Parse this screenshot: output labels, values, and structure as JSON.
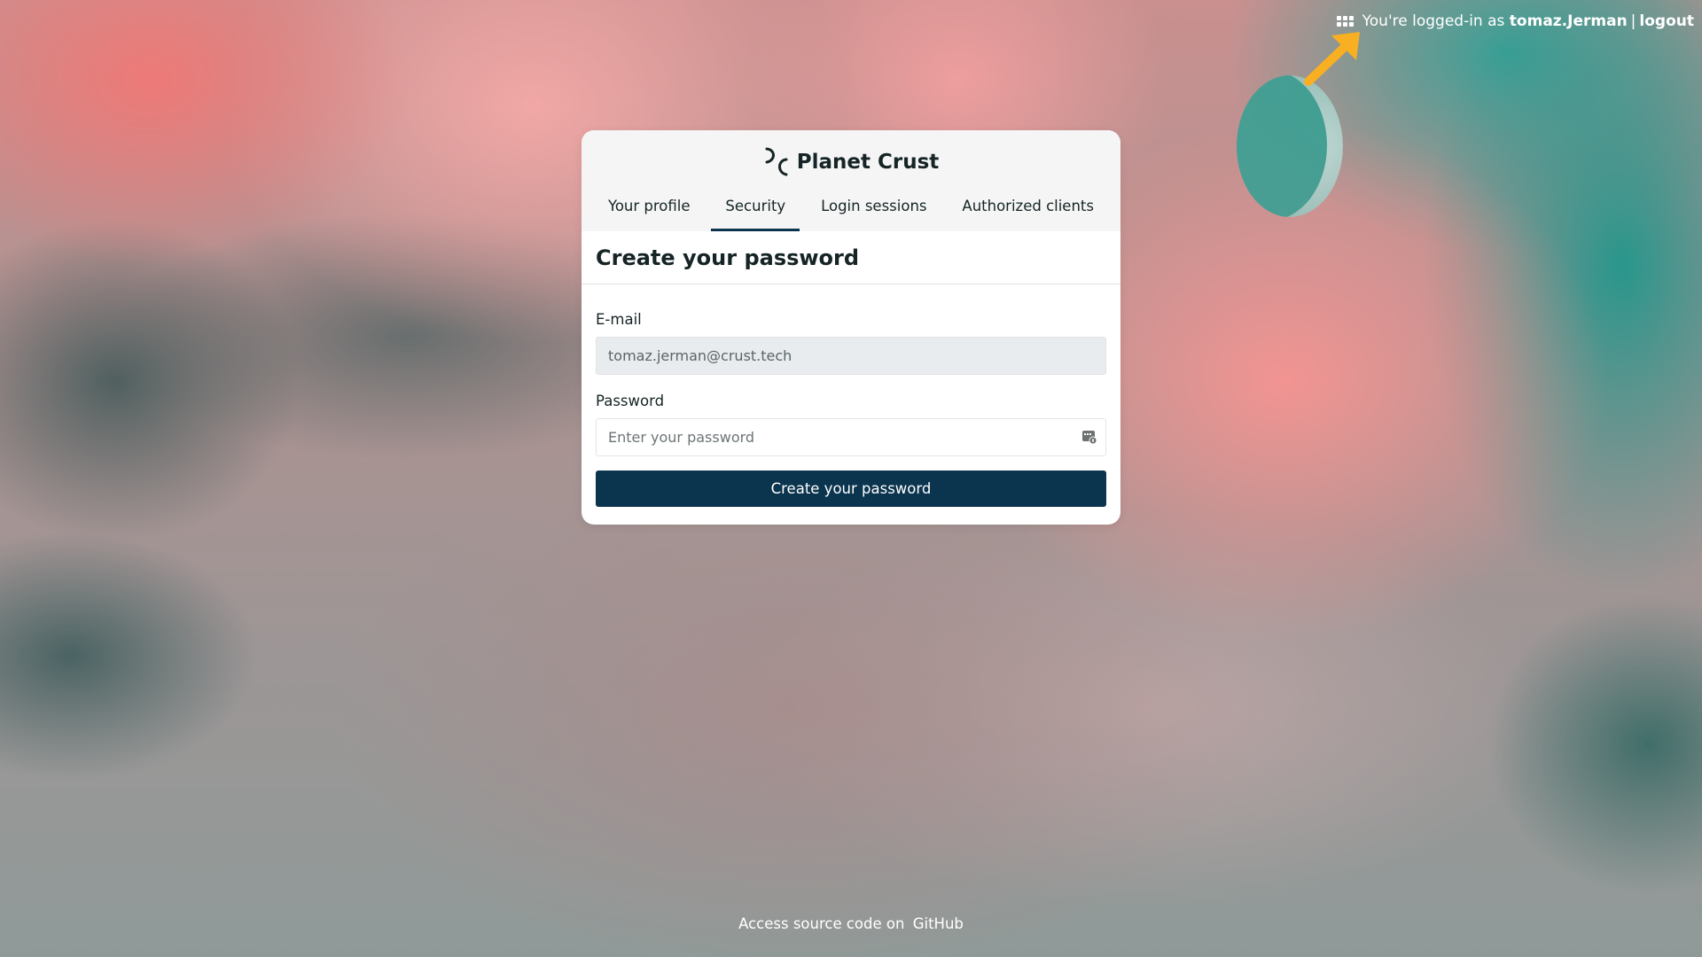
{
  "topbar": {
    "apps_icon": "grid-apps-icon",
    "logged_in_prefix": "You're logged-in as",
    "username": "tomaz.Jerman",
    "separator": "|",
    "logout_label": "logout"
  },
  "brand": {
    "name": "Planet Crust",
    "logo_icon": "planet-crust-logo-icon"
  },
  "tabs": [
    {
      "label": "Your profile",
      "active": false
    },
    {
      "label": "Security",
      "active": true
    },
    {
      "label": "Login sessions",
      "active": false
    },
    {
      "label": "Authorized clients",
      "active": false
    }
  ],
  "section": {
    "title": "Create your password"
  },
  "form": {
    "email_label": "E-mail",
    "email_value": "tomaz.jerman@crust.tech",
    "password_label": "Password",
    "password_placeholder": "Enter your password",
    "password_icon": "password-manager-icon",
    "submit_label": "Create your password"
  },
  "footer": {
    "text": "Access source code on",
    "link_label": "GitHub"
  },
  "colors": {
    "primary": "#0b344e",
    "text": "#162425",
    "annotation_arrow": "#f8b022"
  }
}
